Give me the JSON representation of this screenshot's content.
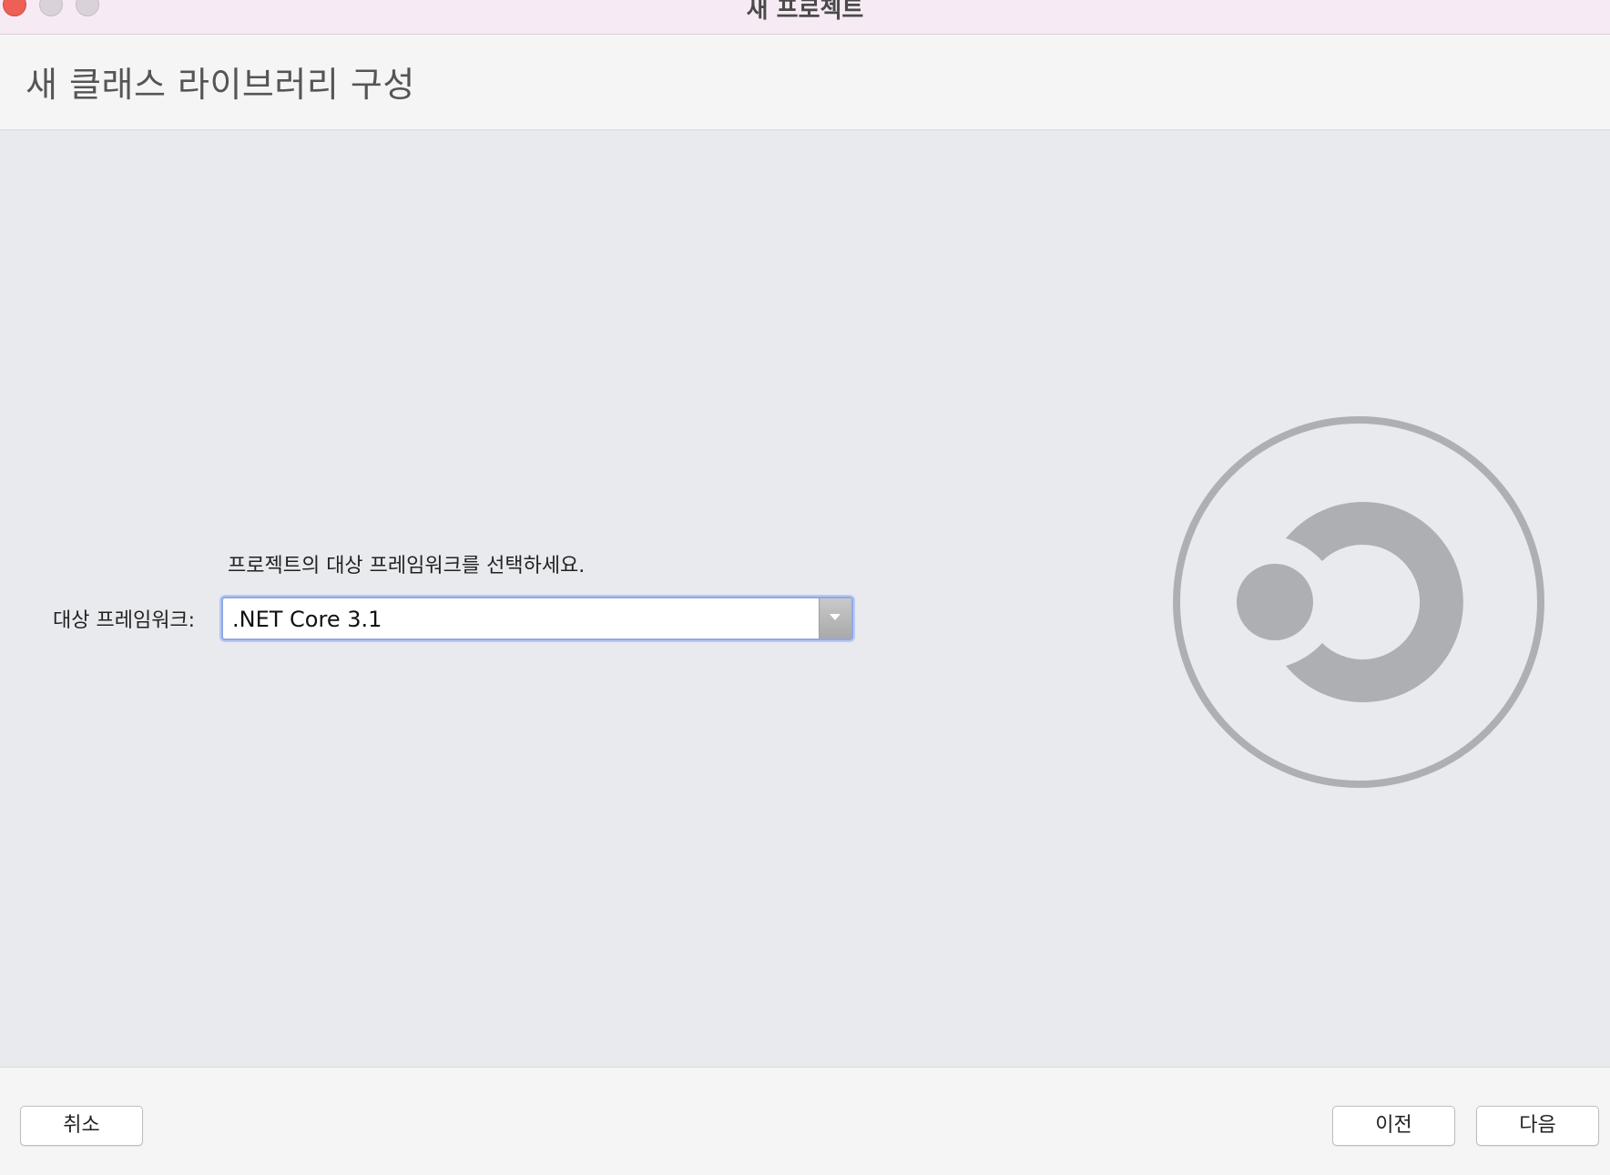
{
  "window": {
    "title": "새 프로젝트",
    "controls": [
      "close",
      "minimize",
      "maximize"
    ]
  },
  "header": {
    "title": "새 클래스 라이브러리 구성"
  },
  "main": {
    "description": "프로젝트의 대상 프레임워크를 선택하세요.",
    "framework_label": "대상 프레임워크:",
    "framework_value": ".NET Core 3.1"
  },
  "logo": {
    "icon": "dotnet-logo-icon",
    "color": "#aeafb2"
  },
  "footer": {
    "cancel_label": "취소",
    "prev_label": "이전",
    "next_label": "다음"
  }
}
